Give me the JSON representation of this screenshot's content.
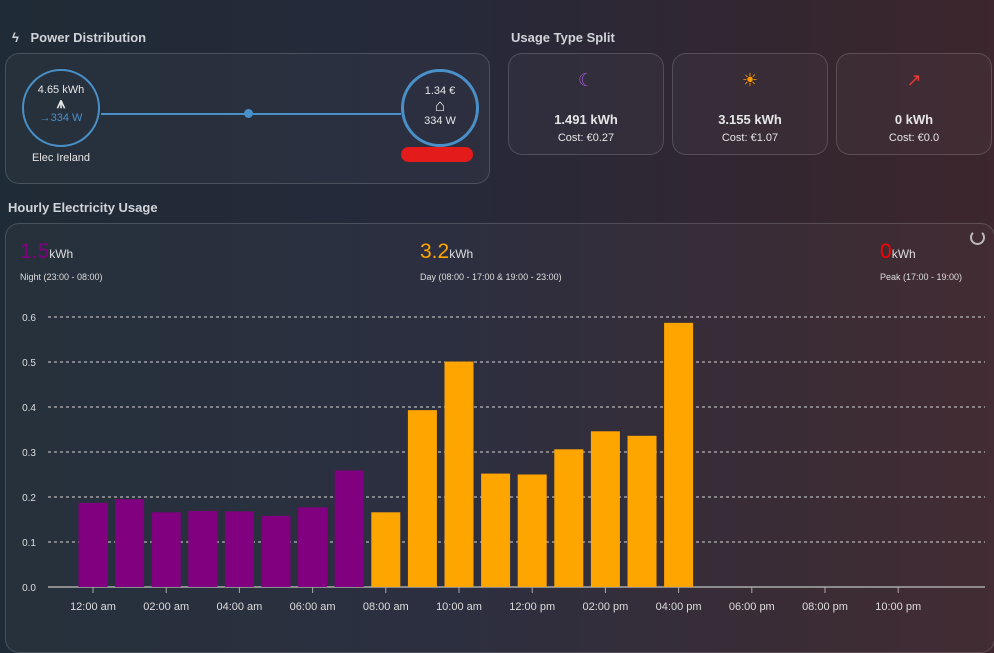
{
  "power_distribution": {
    "title": "Power Distribution",
    "grid": {
      "energy": "4.65 kWh",
      "power": "334 W",
      "label": "Elec Ireland",
      "icon": "transmission-tower-icon"
    },
    "home": {
      "cost": "1.34 €",
      "power": "334 W",
      "icon": "home-icon"
    },
    "line_color": "#4a90c8"
  },
  "usage_split": {
    "title": "Usage Type Split",
    "cards": [
      {
        "icon": "moon-stars-icon",
        "kwh": "1.491 kWh",
        "cost": "Cost: €0.27",
        "color": "#9b59d0"
      },
      {
        "icon": "sun-clock-icon",
        "kwh": "3.155 kWh",
        "cost": "Cost: €1.07",
        "color": "#ff9800"
      },
      {
        "icon": "trending-up-icon",
        "kwh": "0 kWh",
        "cost": "Cost: €0.0",
        "color": "#e53935"
      }
    ]
  },
  "hourly": {
    "title": "Hourly Electricity Usage",
    "stats": [
      {
        "value": "1.5",
        "unit": "kWh",
        "label": "Night (23:00 - 08:00)",
        "color": "#800080"
      },
      {
        "value": "3.2",
        "unit": "kWh",
        "label": "Day (08:00 - 17:00 & 19:00 - 23:00)",
        "color": "#ffa500"
      },
      {
        "value": "0",
        "unit": "kWh",
        "label": "Peak (17:00 - 19:00)",
        "color": "#ff0000"
      }
    ]
  },
  "chart_data": {
    "type": "bar",
    "ylim": [
      0,
      0.6
    ],
    "y_ticks": [
      "0.0",
      "0.1",
      "0.2",
      "0.3",
      "0.4",
      "0.5",
      "0.6"
    ],
    "x_ticks": [
      "12:00 am",
      "02:00 am",
      "04:00 am",
      "06:00 am",
      "08:00 am",
      "10:00 am",
      "12:00 pm",
      "02:00 pm",
      "04:00 pm",
      "06:00 pm",
      "08:00 pm",
      "10:00 pm"
    ],
    "grid": true,
    "hours": [
      0,
      1,
      2,
      3,
      4,
      5,
      6,
      7,
      8,
      9,
      10,
      11,
      12,
      13,
      14,
      15,
      16
    ],
    "values": [
      0.187,
      0.195,
      0.166,
      0.169,
      0.168,
      0.158,
      0.177,
      0.259,
      0.166,
      0.393,
      0.501,
      0.252,
      0.25,
      0.306,
      0.346,
      0.336,
      0.587
    ],
    "bar_types": [
      "night",
      "night",
      "night",
      "night",
      "night",
      "night",
      "night",
      "night",
      "day",
      "day",
      "day",
      "day",
      "day",
      "day",
      "day",
      "day",
      "day"
    ],
    "colors": {
      "night": "#800080",
      "day": "#ffa500",
      "peak": "#ff0000"
    }
  }
}
